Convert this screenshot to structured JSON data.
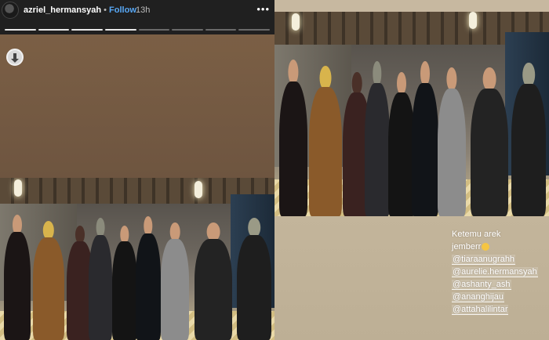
{
  "story": {
    "username": "azriel_hermansyah",
    "separator": "•",
    "follow_label": "Follow",
    "time_ago": "13h",
    "more_label": "•••",
    "progress": {
      "segments": 8,
      "completed": 4
    }
  },
  "caption": {
    "line1": "Ketemu arek",
    "line2": "jemberr",
    "mentions": [
      "@tiaraanugrahh",
      "@aurelie.hermansyah",
      "@ashanty_ash",
      "@ananghijau",
      "@attahalilintar"
    ]
  },
  "colors": {
    "header_bg": "#202020",
    "follow_blue": "#58a8f5",
    "story_brown": "#7a5e44",
    "right_bg": "#c2b49b"
  }
}
